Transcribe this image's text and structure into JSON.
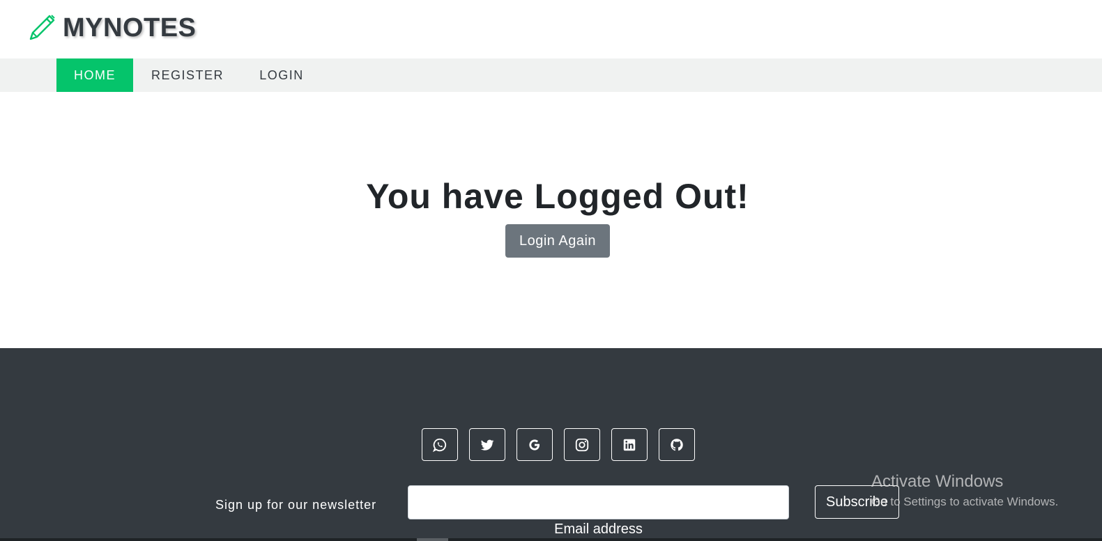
{
  "brand": {
    "name": "MYNOTES",
    "icon": "pencil-icon",
    "accent": "#05c46b"
  },
  "nav": {
    "items": [
      {
        "label": "HOME",
        "active": true
      },
      {
        "label": "REGISTER",
        "active": false
      },
      {
        "label": "LOGIN",
        "active": false
      }
    ]
  },
  "main": {
    "title": "You have Logged Out!",
    "login_again_label": "Login Again"
  },
  "footer": {
    "social": [
      {
        "icon": "whatsapp-icon"
      },
      {
        "icon": "twitter-icon"
      },
      {
        "icon": "google-icon"
      },
      {
        "icon": "instagram-icon"
      },
      {
        "icon": "linkedin-icon"
      },
      {
        "icon": "github-icon"
      }
    ],
    "newsletter_label": "Sign up for our newsletter",
    "email_value": "",
    "email_hint": "Email address",
    "subscribe_label": "Subscribe"
  },
  "os_overlay": {
    "title": "Activate Windows",
    "subtitle": "Go to Settings to activate Windows."
  },
  "colors": {
    "nav_active_bg": "#05c46b",
    "footer_bg": "#343a40",
    "button_secondary": "#6c757d"
  }
}
